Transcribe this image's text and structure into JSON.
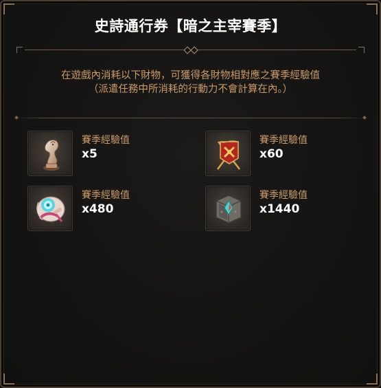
{
  "dialog": {
    "title": "史詩通行券【暗之主宰賽季】",
    "description_line1": "在遊戲內消耗以下財物，可獲得各財物相對應之賽季經驗值",
    "description_line2": "（派遣任務中所消耗的行動力不會計算在內。）"
  },
  "items": [
    {
      "icon": "chess-knight-icon",
      "label": "賽季經驗值",
      "value": "x5"
    },
    {
      "icon": "war-banner-icon",
      "label": "賽季經驗值",
      "value": "x60"
    },
    {
      "icon": "magic-scroll-icon",
      "label": "賽季經驗值",
      "value": "x480"
    },
    {
      "icon": "stone-crystal-icon",
      "label": "賽季經驗值",
      "value": "x1440"
    }
  ],
  "colors": {
    "accent_text": "#c99b6a",
    "frame_gold": "#8a7352",
    "background": "#151413"
  }
}
